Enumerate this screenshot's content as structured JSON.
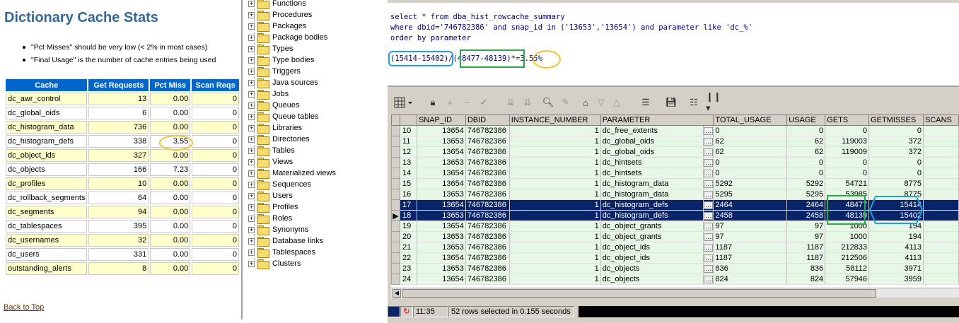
{
  "report": {
    "title": "Dictionary Cache Stats",
    "notes": [
      "\"Pct Misses\"  should be very low (< 2% in most cases)",
      "\"Final Usage\" is the number of cache entries being used"
    ],
    "columns": [
      "Cache",
      "Get Requests",
      "Pct Miss",
      "Scan Reqs"
    ],
    "rows": [
      [
        "dc_awr_control",
        "13",
        "0.00",
        "0"
      ],
      [
        "dc_global_oids",
        "6",
        "0.00",
        "0"
      ],
      [
        "dc_histogram_data",
        "736",
        "0.00",
        "0"
      ],
      [
        "dc_histogram_defs",
        "338",
        "3.55",
        "0"
      ],
      [
        "dc_object_ids",
        "327",
        "0.00",
        "0"
      ],
      [
        "dc_objects",
        "166",
        "7.23",
        "0"
      ],
      [
        "dc_profiles",
        "10",
        "0.00",
        "0"
      ],
      [
        "dc_rollback_segments",
        "64",
        "0.00",
        "0"
      ],
      [
        "dc_segments",
        "94",
        "0.00",
        "0"
      ],
      [
        "dc_tablespaces",
        "395",
        "0.00",
        "0"
      ],
      [
        "dc_usernames",
        "32",
        "0.00",
        "0"
      ],
      [
        "dc_users",
        "331",
        "0.00",
        "0"
      ],
      [
        "outstanding_alerts",
        "8",
        "0.00",
        "0"
      ]
    ],
    "back_to_top": "Back to Top"
  },
  "tree": {
    "items": [
      "Functions",
      "Procedures",
      "Packages",
      "Package bodies",
      "Types",
      "Type bodies",
      "Triggers",
      "Java sources",
      "Jobs",
      "Queues",
      "Queue tables",
      "Libraries",
      "Directories",
      "Tables",
      "Views",
      "Materialized views",
      "Sequences",
      "Users",
      "Profiles",
      "Roles",
      "Synonyms",
      "Database links",
      "Tablespaces",
      "Clusters"
    ]
  },
  "sql": {
    "lines": [
      "select * from dba_hist_rowcache_summary",
      "where dbid='746782386' and snap_id in ('13653','13654') and parameter like 'dc_%'",
      "order by parameter"
    ],
    "calc": "(15414-15402)/(48477-48139)*=3.55%"
  },
  "grid": {
    "columns": [
      "SNAP_ID",
      "DBID",
      "INSTANCE_NUMBER",
      "PARAMETER",
      "TOTAL_USAGE",
      "USAGE",
      "GETS",
      "GETMISSES",
      "SCANS"
    ],
    "rows": [
      {
        "n": "10",
        "v": [
          "13654",
          "746782386",
          "1",
          "dc_free_extents",
          "0",
          "0",
          "0",
          "0",
          ""
        ]
      },
      {
        "n": "11",
        "v": [
          "13653",
          "746782386",
          "1",
          "dc_global_oids",
          "62",
          "62",
          "119003",
          "372",
          ""
        ]
      },
      {
        "n": "12",
        "v": [
          "13654",
          "746782386",
          "1",
          "dc_global_oids",
          "62",
          "62",
          "119009",
          "372",
          ""
        ]
      },
      {
        "n": "13",
        "v": [
          "13653",
          "746782386",
          "1",
          "dc_hintsets",
          "0",
          "0",
          "0",
          "0",
          ""
        ]
      },
      {
        "n": "14",
        "v": [
          "13654",
          "746782386",
          "1",
          "dc_hintsets",
          "0",
          "0",
          "0",
          "0",
          ""
        ]
      },
      {
        "n": "15",
        "v": [
          "13654",
          "746782386",
          "1",
          "dc_histogram_data",
          "5292",
          "5292",
          "54721",
          "8775",
          ""
        ]
      },
      {
        "n": "16",
        "v": [
          "13653",
          "746782386",
          "1",
          "dc_histogram_data",
          "5295",
          "5295",
          "53985",
          "8775",
          ""
        ]
      },
      {
        "n": "17",
        "v": [
          "13654",
          "746782386",
          "1",
          "dc_histogram_defs",
          "2464",
          "2464",
          "48477",
          "15414",
          ""
        ]
      },
      {
        "n": "18",
        "v": [
          "13653",
          "746782386",
          "1",
          "dc_histogram_defs",
          "2458",
          "2458",
          "48139",
          "15402",
          ""
        ]
      },
      {
        "n": "19",
        "v": [
          "13654",
          "746782386",
          "1",
          "dc_object_grants",
          "97",
          "97",
          "1000",
          "194",
          ""
        ]
      },
      {
        "n": "20",
        "v": [
          "13653",
          "746782386",
          "1",
          "dc_object_grants",
          "97",
          "97",
          "1000",
          "194",
          ""
        ]
      },
      {
        "n": "21",
        "v": [
          "13653",
          "746782386",
          "1",
          "dc_object_ids",
          "1187",
          "1187",
          "212833",
          "4113",
          ""
        ]
      },
      {
        "n": "22",
        "v": [
          "13654",
          "746782386",
          "1",
          "dc_object_ids",
          "1187",
          "1187",
          "212506",
          "4113",
          ""
        ]
      },
      {
        "n": "23",
        "v": [
          "13653",
          "746782386",
          "1",
          "dc_objects",
          "836",
          "836",
          "58112",
          "3971",
          ""
        ]
      },
      {
        "n": "24",
        "v": [
          "13654",
          "746782386",
          "1",
          "dc_objects",
          "824",
          "824",
          "57946",
          "3959",
          ""
        ]
      }
    ]
  },
  "status": {
    "time": "11:35",
    "message": "52 rows selected in 0.155 seconds"
  }
}
